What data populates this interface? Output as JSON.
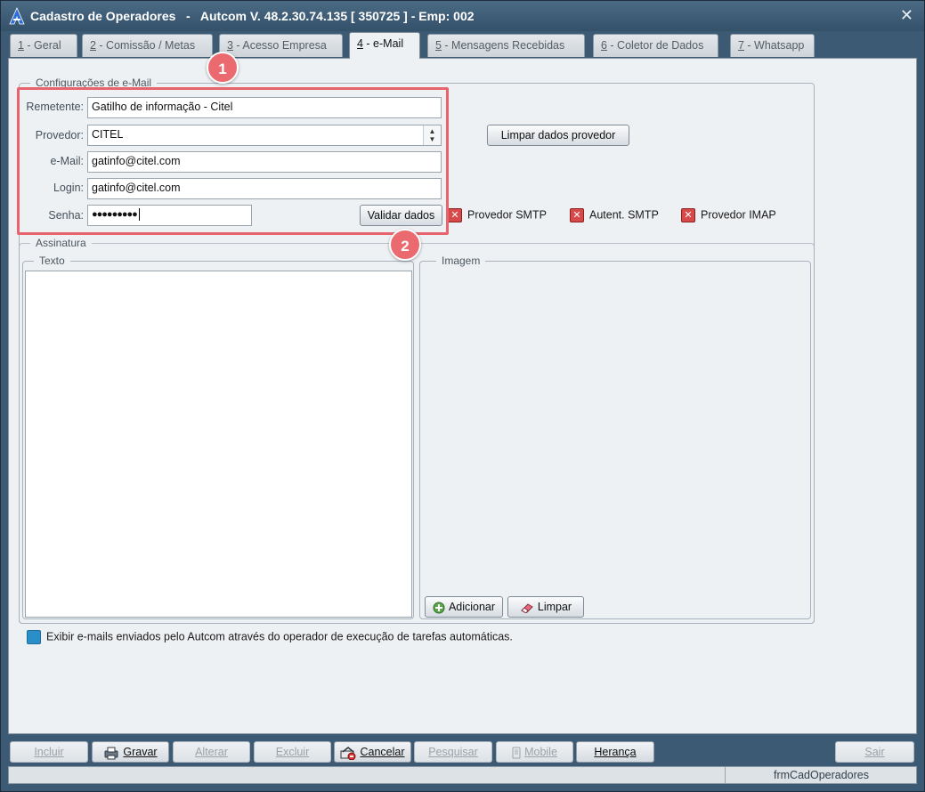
{
  "window": {
    "title": "Cadastro de Operadores   -   Autcom V. 48.2.30.74.135 [ 350725 ] - Emp: 002",
    "close_glyph": "✕"
  },
  "tabs": [
    {
      "num": "1",
      "label": " - Geral"
    },
    {
      "num": "2",
      "label": " - Comissão / Metas"
    },
    {
      "num": "3",
      "label": " - Acesso Empresa"
    },
    {
      "num": "4",
      "label": " - e-Mail"
    },
    {
      "num": "5",
      "label": " - Mensagens Recebidas"
    },
    {
      "num": "6",
      "label": " - Coletor de Dados"
    },
    {
      "num": "7",
      "label": " - Whatsapp"
    }
  ],
  "active_tab": "4 - e-Mail",
  "email_config": {
    "legend": "Configurações de e-Mail",
    "remetente_label": "Remetente:",
    "remetente_value": "Gatilho de informação - Citel",
    "provedor_label": "Provedor:",
    "provedor_value": "CITEL",
    "email_label": "e-Mail:",
    "email_value": "gatinfo@citel.com",
    "login_label": "Login:",
    "login_value": "gatinfo@citel.com",
    "senha_label": "Senha:",
    "senha_value": "●●●●●●●●●",
    "validar_button": "Validar dados",
    "limpar_provedor_button": "Limpar dados provedor",
    "status": [
      {
        "label": "Provedor SMTP",
        "checked": false
      },
      {
        "label": "Autent. SMTP",
        "checked": false
      },
      {
        "label": "Provedor IMAP",
        "checked": false
      }
    ]
  },
  "annotations": {
    "badge1": "1",
    "badge2": "2",
    "highlight_color": "#e8646c"
  },
  "assinatura": {
    "legend": "Assinatura",
    "texto_legend": "Texto",
    "imagem_legend": "Imagem",
    "adicionar_button": "Adicionar",
    "limpar_button": "Limpar"
  },
  "exibir_checkbox": "Exibir e-mails enviados pelo Autcom através do operador de execução de tarefas automáticas.",
  "toolbar": {
    "incluir": "Incluir",
    "gravar": "Gravar",
    "alterar": "Alterar",
    "excluir": "Excluir",
    "cancelar": "Cancelar",
    "pesquisar": "Pesquisar",
    "mobile": "Mobile",
    "heranca": "Herança",
    "sair": "Sair"
  },
  "statusbar": {
    "form_name": "frmCadOperadores"
  },
  "colors": {
    "accent": "#3c5a73",
    "error_checkbox": "#d84a4a",
    "checkbox_blue": "#2a8fc9"
  }
}
